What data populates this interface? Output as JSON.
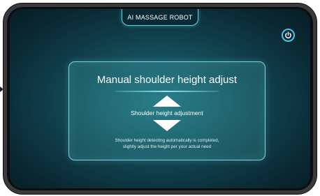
{
  "header": {
    "title": "AI MASSAGE ROBOT"
  },
  "toolbar": {
    "power_icon": "power-icon"
  },
  "panel": {
    "title": "Manual shoulder height adjust",
    "adjust_label": "Shoulder height adjustment",
    "up_icon": "triangle-up-icon",
    "down_icon": "triangle-down-icon",
    "description_line1": "Shoulder height detecting automatically is completed,",
    "description_line2": "slightly adjust the height per your actual need"
  },
  "colors": {
    "accent": "#4ec3ea",
    "panel_border": "#79d6df",
    "background_center": "#1f6f7c",
    "background_edge": "#071c24"
  }
}
